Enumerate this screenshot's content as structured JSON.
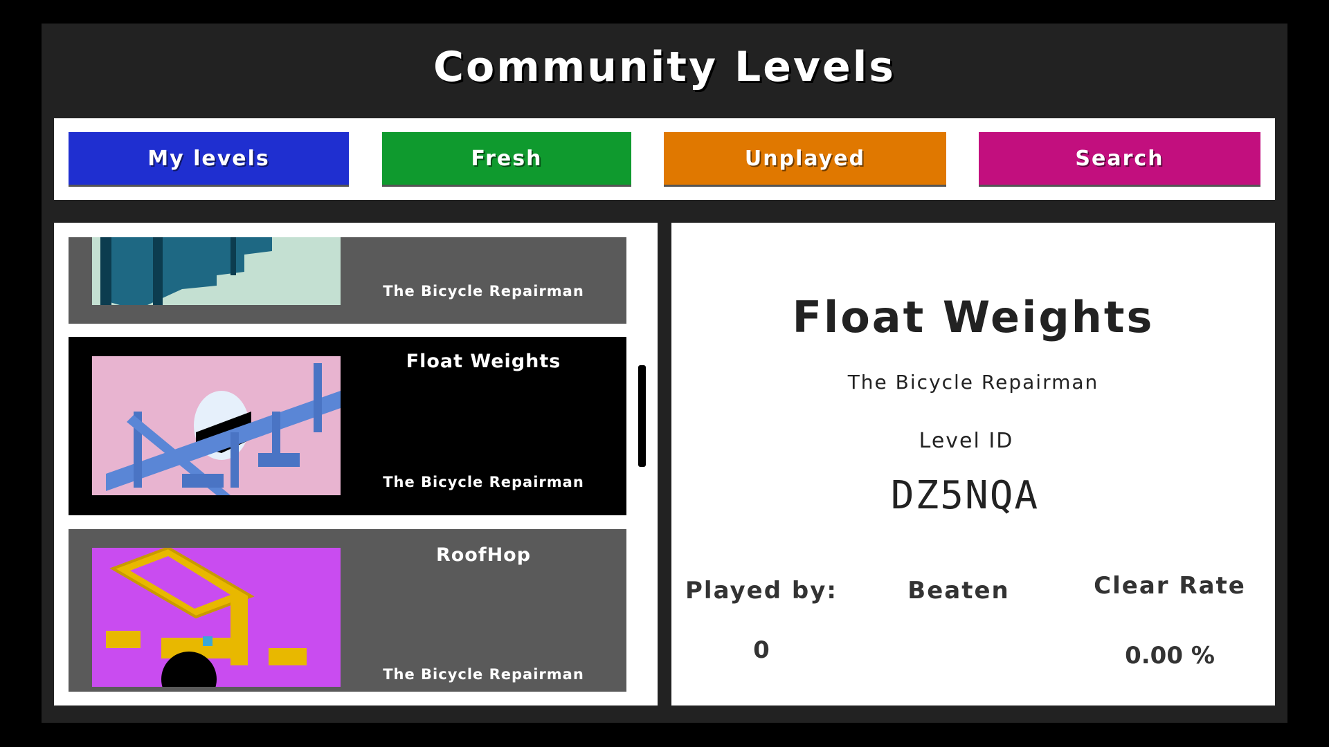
{
  "title": "Community Levels",
  "tabs": [
    {
      "label": "My levels",
      "color": "#1f2fd0"
    },
    {
      "label": "Fresh",
      "color": "#0f9a2e"
    },
    {
      "label": "Unplayed",
      "color": "#e07800"
    },
    {
      "label": "Search",
      "color": "#c20f7e"
    }
  ],
  "levels": [
    {
      "name": "",
      "author": "The Bicycle Repairman",
      "selected": false
    },
    {
      "name": "Float Weights",
      "author": "The Bicycle Repairman",
      "selected": true
    },
    {
      "name": "RoofHop",
      "author": "The Bicycle Repairman",
      "selected": false
    }
  ],
  "detail": {
    "name": "Float Weights",
    "author": "The Bicycle Repairman",
    "level_id_label": "Level ID",
    "level_id": "DZ5NQA",
    "played_by_label": "Played by:",
    "played_by": "0",
    "beaten_label": "Beaten",
    "beaten": "",
    "clear_rate_label": "Clear Rate",
    "clear_rate": "0.00 %"
  }
}
